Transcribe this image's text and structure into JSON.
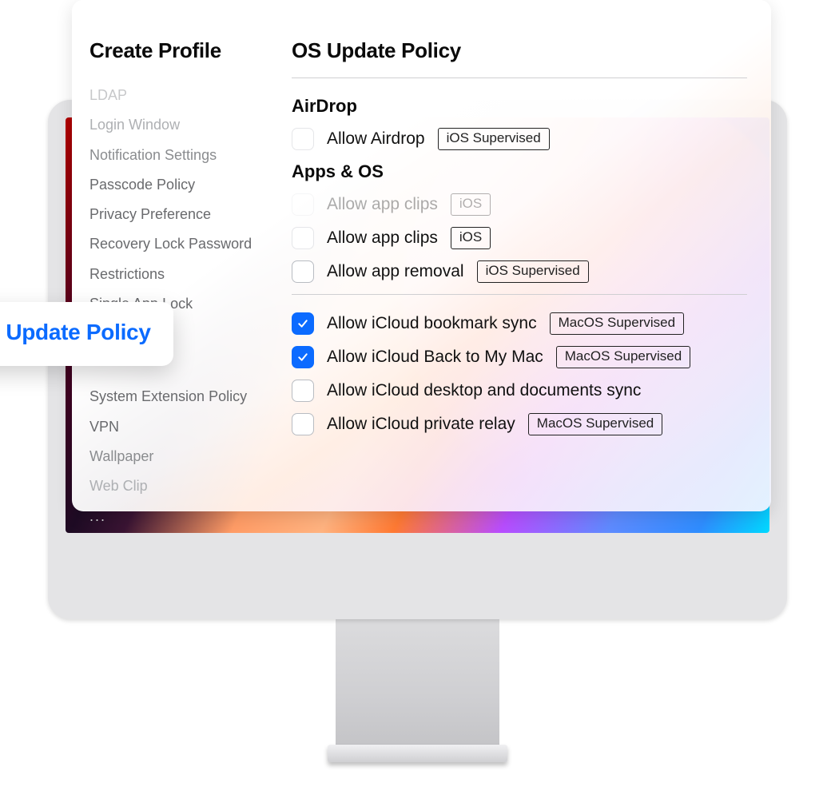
{
  "sidebar": {
    "title": "Create Profile",
    "items": [
      {
        "label": "LDAP",
        "shade": "fade-strong"
      },
      {
        "label": "Login Window",
        "shade": "fade-med"
      },
      {
        "label": "Notification Settings",
        "shade": "fade-light"
      },
      {
        "label": "Passcode Policy",
        "shade": ""
      },
      {
        "label": "Privacy Preference",
        "shade": ""
      },
      {
        "label": "Recovery Lock Password",
        "shade": ""
      },
      {
        "label": "Restrictions",
        "shade": ""
      },
      {
        "label": "Single App Lock",
        "shade": ""
      },
      {
        "label": "System Extension Policy",
        "shade": ""
      },
      {
        "label": "VPN",
        "shade": ""
      },
      {
        "label": "Wallpaper",
        "shade": "fade-light"
      },
      {
        "label": "Web Clip",
        "shade": "fade-med"
      },
      {
        "label": "...",
        "shade": "dots"
      }
    ],
    "highlighted": "OS Update Policy"
  },
  "main": {
    "title": "OS Update Policy",
    "sections": [
      {
        "heading": "AirDrop",
        "options": [
          {
            "label": "Allow Airdrop",
            "tag": "iOS Supervised",
            "checked": false,
            "style": "ghost"
          }
        ]
      },
      {
        "heading": "Apps & OS",
        "options": [
          {
            "label": "Allow app clips",
            "tag": "iOS",
            "checked": false,
            "style": "ghost",
            "faded": true
          },
          {
            "label": "Allow app clips",
            "tag": "iOS",
            "checked": false,
            "style": "ghost"
          },
          {
            "label": "Allow app removal",
            "tag": "iOS Supervised",
            "checked": false,
            "style": "normal"
          }
        ]
      }
    ],
    "icloud_options": [
      {
        "label": "Allow iCloud bookmark sync",
        "tag": "MacOS Supervised",
        "checked": true,
        "style": "normal"
      },
      {
        "label": "Allow iCloud Back to My Mac",
        "tag": "MacOS Supervised",
        "checked": true,
        "style": "normal"
      },
      {
        "label": "Allow iCloud desktop and documents sync",
        "tag": "",
        "checked": false,
        "style": "normal"
      },
      {
        "label": "Allow iCloud private relay",
        "tag": "MacOS Supervised",
        "checked": false,
        "style": "normal"
      }
    ]
  }
}
